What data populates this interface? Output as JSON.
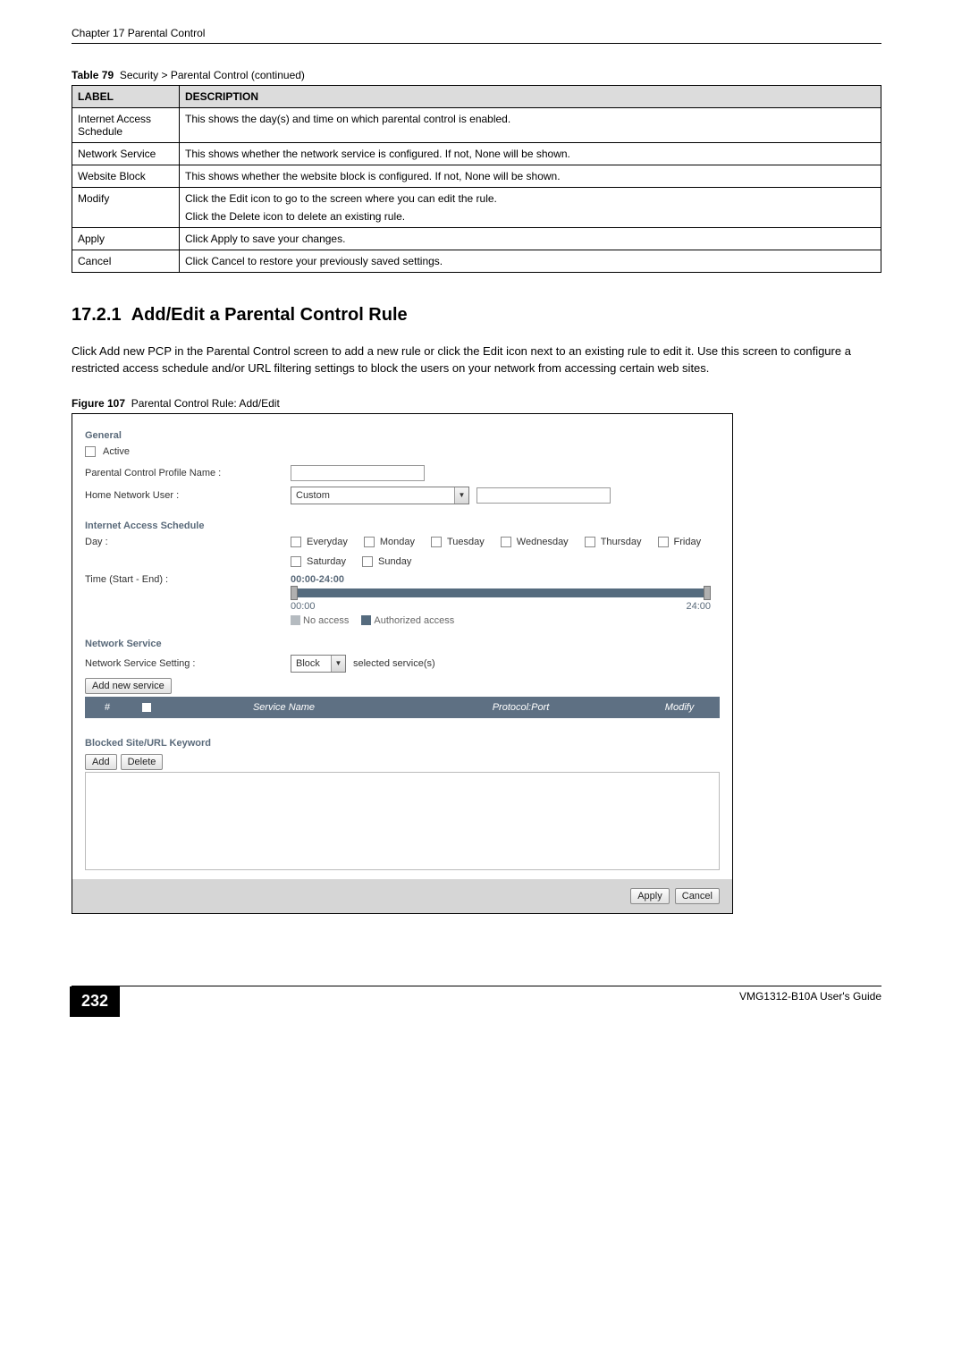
{
  "header": {
    "chapter": "Chapter 17 Parental Control"
  },
  "table79": {
    "caption_label": "Table 79",
    "caption_text": "Security > Parental Control (continued)",
    "head": {
      "label": "LABEL",
      "desc": "DESCRIPTION"
    },
    "rows": [
      {
        "label": "Internet Access Schedule",
        "desc": "This shows the day(s) and time on which parental control is enabled."
      },
      {
        "label": "Network Service",
        "desc": "This shows whether the network service is configured. If not, None will be shown."
      },
      {
        "label": "Website Block",
        "desc": "This shows whether the website block is configured. If not, None will be shown."
      },
      {
        "label": "Modify",
        "desc_line1": "Click the Edit icon to go to the screen where you can edit the rule.",
        "desc_line2": "Click the Delete icon to delete an existing rule."
      },
      {
        "label": "Apply",
        "desc": "Click Apply to save your changes."
      },
      {
        "label": "Cancel",
        "desc": "Click Cancel to restore your previously saved settings."
      }
    ]
  },
  "section": {
    "number": "17.2.1",
    "title": "Add/Edit a Parental Control Rule",
    "body": "Click Add new PCP in the Parental Control screen to add a new rule or click the Edit icon next to an existing rule to edit it. Use this screen to configure a restricted access schedule and/or URL filtering settings to block the users on your network from accessing certain web sites."
  },
  "figure107": {
    "caption_label": "Figure 107",
    "caption_text": "Parental Control Rule: Add/Edit",
    "general": {
      "heading": "General",
      "active_label": "Active",
      "profile_name_label": "Parental Control Profile Name :",
      "home_user_label": "Home Network User :",
      "home_user_value": "Custom"
    },
    "schedule": {
      "heading": "Internet Access Schedule",
      "day_label": "Day :",
      "days": [
        "Everyday",
        "Monday",
        "Tuesday",
        "Wednesday",
        "Thursday",
        "Friday",
        "Saturday",
        "Sunday"
      ],
      "time_label": "Time (Start - End) :",
      "time_range": "00:00-24:00",
      "time_start": "00:00",
      "time_end": "24:00",
      "legend_no_access": "No access",
      "legend_auth": "Authorized access"
    },
    "network_service": {
      "heading": "Network Service",
      "setting_label": "Network Service Setting :",
      "setting_value": "Block",
      "setting_suffix": "selected service(s)",
      "add_button": "Add new service",
      "cols": {
        "hash": "#",
        "name": "Service Name",
        "proto": "Protocol:Port",
        "modify": "Modify"
      }
    },
    "blocked": {
      "heading": "Blocked Site/URL Keyword",
      "add_button": "Add",
      "delete_button": "Delete"
    },
    "footer": {
      "apply": "Apply",
      "cancel": "Cancel"
    }
  },
  "page_footer": {
    "page_number": "232",
    "guide": "VMG1312-B10A User's Guide"
  }
}
